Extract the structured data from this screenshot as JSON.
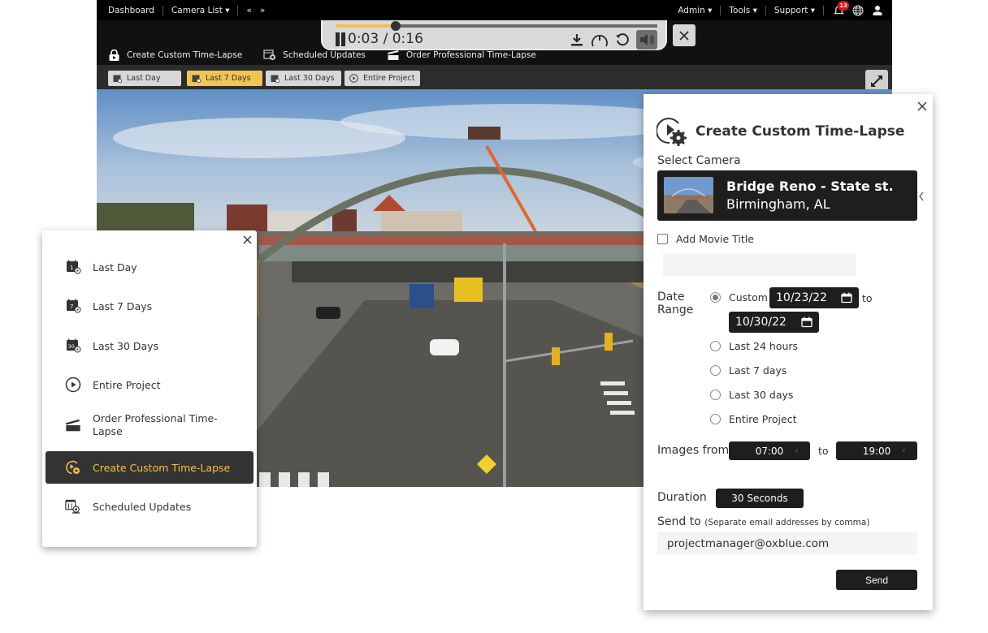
{
  "topnav": {
    "left_items": [
      "Dashboard",
      "Camera List ▾"
    ],
    "prev_label": "«",
    "next_label": "»",
    "right_items": [
      "Admin ▾",
      "Tools ▾",
      "Support ▾"
    ],
    "notification_count": "13"
  },
  "toolbar": {
    "links": [
      "Create Custom Time-Lapse",
      "Scheduled Updates",
      "Order Professional Time-Lapse"
    ]
  },
  "player": {
    "current_time": "0:03",
    "total_time": "0:16",
    "time_display": "0:03 / 0:16",
    "progress_fraction": 0.1875,
    "accent_color": "#f0c24d"
  },
  "range_buttons": [
    {
      "label": "Last Day",
      "active": false
    },
    {
      "label": "Last 7 Days",
      "active": true
    },
    {
      "label": "Last 30 Days",
      "active": false
    },
    {
      "label": "Entire Project",
      "active": false
    }
  ],
  "menu_panel": {
    "items": [
      {
        "label": "Last Day",
        "icon": "calendar-1-icon"
      },
      {
        "label": "Last 7 Days",
        "icon": "calendar-7-icon"
      },
      {
        "label": "Last 30 Days",
        "icon": "calendar-30-icon"
      },
      {
        "label": "Entire Project",
        "icon": "play-circle-icon"
      },
      {
        "label": "Order Professional Time-Lapse",
        "icon": "clapperboard-icon"
      },
      {
        "label": "Create Custom Time-Lapse",
        "icon": "play-gear-icon",
        "active": true
      },
      {
        "label": "Scheduled Updates",
        "icon": "calendar-camera-icon"
      }
    ]
  },
  "modal": {
    "title": "Create Custom Time-Lapse",
    "select_camera_label": "Select Camera",
    "camera": {
      "name": "Bridge Reno - State st.",
      "location": "Birmingham, AL"
    },
    "add_movie_title_label": "Add Movie Title",
    "movie_title_value": "",
    "date_range_label_1": "Date",
    "date_range_label_2": "Range",
    "date_options": [
      {
        "label": "Custom",
        "checked": true
      },
      {
        "label": "Last 24 hours",
        "checked": false
      },
      {
        "label": "Last 7 days",
        "checked": false
      },
      {
        "label": "Last 30 days",
        "checked": false
      },
      {
        "label": "Entire Project",
        "checked": false
      }
    ],
    "date_from": "10/23/22",
    "date_to": "10/30/22",
    "to_label": "to",
    "images_from_label": "Images from",
    "time_from": "07:00",
    "time_to": "19:00",
    "duration_label": "Duration",
    "duration_value": "30 Seconds",
    "send_to_label": "Send to",
    "send_to_hint": "(Separate email addresses by comma)",
    "email_value": "projectmanager@oxblue.com",
    "send_label": "Send"
  }
}
